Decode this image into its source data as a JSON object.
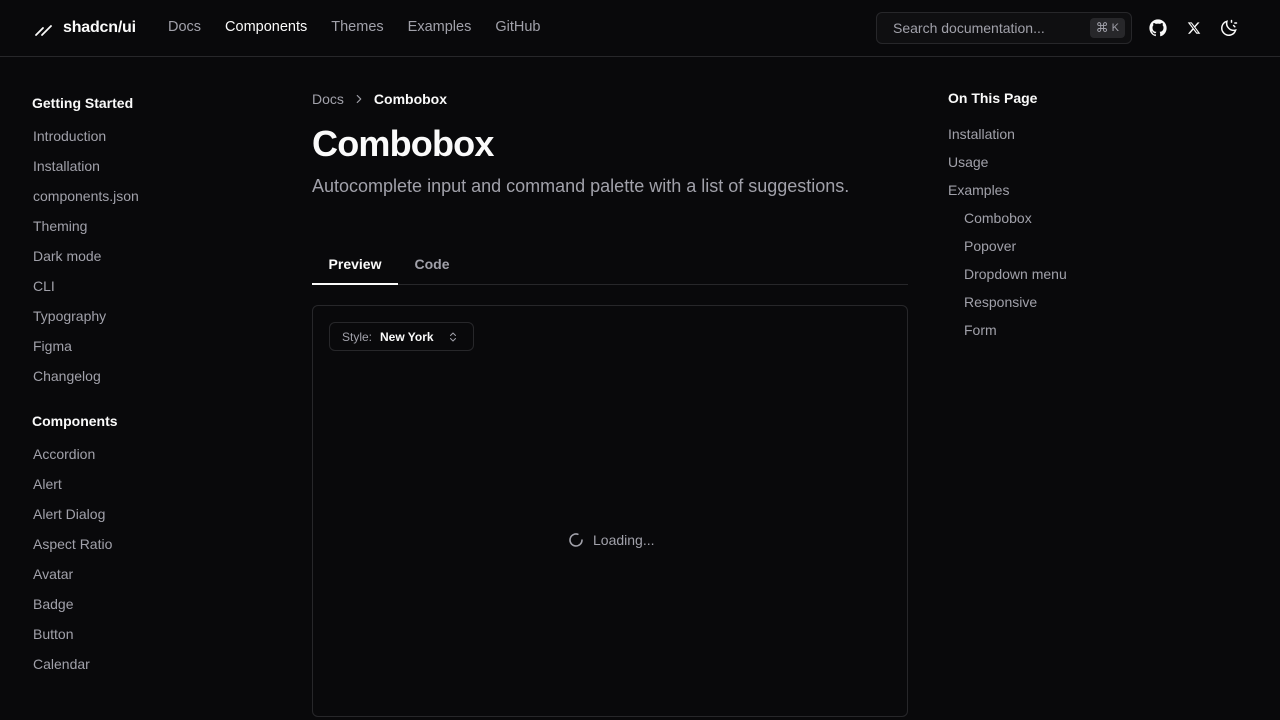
{
  "header": {
    "brand": "shadcn/ui",
    "nav": [
      {
        "label": "Docs",
        "active": false
      },
      {
        "label": "Components",
        "active": true
      },
      {
        "label": "Themes",
        "active": false
      },
      {
        "label": "Examples",
        "active": false
      },
      {
        "label": "GitHub",
        "active": false
      }
    ],
    "search_placeholder": "Search documentation...",
    "shortcut_symbol": "⌘",
    "shortcut_key": "K",
    "icons": [
      "github-icon",
      "x-icon",
      "theme-toggle-icon"
    ]
  },
  "sidebar": {
    "sections": [
      {
        "title": "Getting Started",
        "items": [
          "Introduction",
          "Installation",
          "components.json",
          "Theming",
          "Dark mode",
          "CLI",
          "Typography",
          "Figma",
          "Changelog"
        ]
      },
      {
        "title": "Components",
        "items": [
          "Accordion",
          "Alert",
          "Alert Dialog",
          "Aspect Ratio",
          "Avatar",
          "Badge",
          "Button",
          "Calendar"
        ]
      }
    ]
  },
  "main": {
    "breadcrumb": {
      "root": "Docs",
      "current": "Combobox"
    },
    "title": "Combobox",
    "description": "Autocomplete input and command palette with a list of suggestions.",
    "tabs": [
      {
        "label": "Preview",
        "active": true
      },
      {
        "label": "Code",
        "active": false
      }
    ],
    "preview": {
      "style_label": "Style:",
      "style_value": "New York",
      "loading_text": "Loading..."
    }
  },
  "toc": {
    "title": "On This Page",
    "items": [
      {
        "label": "Installation",
        "level": 1
      },
      {
        "label": "Usage",
        "level": 1
      },
      {
        "label": "Examples",
        "level": 1
      },
      {
        "label": "Combobox",
        "level": 2
      },
      {
        "label": "Popover",
        "level": 2
      },
      {
        "label": "Dropdown menu",
        "level": 2
      },
      {
        "label": "Responsive",
        "level": 2
      },
      {
        "label": "Form",
        "level": 2
      }
    ]
  },
  "colors": {
    "background": "#09090b",
    "border": "#27272a",
    "foreground": "#fafafa",
    "muted": "#a1a1aa"
  }
}
